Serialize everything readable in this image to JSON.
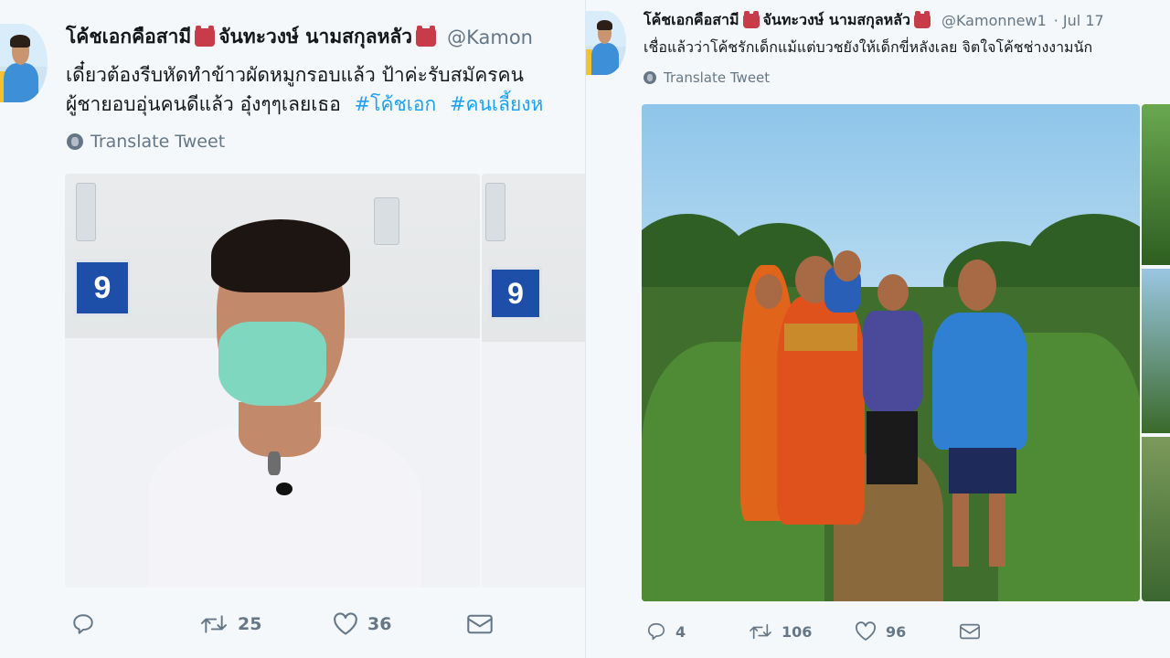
{
  "left_tweet": {
    "display_name": "โค้ชเอกคือสามี",
    "display_name_2": "จันทะวงษ์ นามสกุลหลัว",
    "handle": "@Kamon",
    "text_line_1": "เดี๋ยวต้องรีบหัดทำข้าวผัดหมูกรอบแล้ว ป้าค่ะรับสมัครคน",
    "text_line_2": "ผู้ชายอบอุ่นคนดีแล้ว อุ๋งๆๆเลยเธอ",
    "hashtag_1": "#โค้ชเอก",
    "hashtag_2": "#คนเลี้ยงห",
    "translate_label": "Translate Tweet",
    "bed_number": "9",
    "retweets": "25",
    "likes": "36"
  },
  "right_tweet": {
    "display_name": "โค้ชเอกคือสามี",
    "display_name_2": "จันทะวงษ์ นามสกุลหลัว",
    "handle": "@Kamonnew1",
    "timestamp": "· Jul 17",
    "text_line_1": "เชื่อแล้วว่าโค้ชรักเด็กแม้แต่บวชยังให้เด็กขี่หลังเลย จิตใจโค้ชช่างงามนัก",
    "translate_label": "Translate Tweet",
    "replies": "4",
    "retweets": "106",
    "likes": "96"
  },
  "colors": {
    "text": "#14171a",
    "muted": "#657786",
    "link": "#1da1f2",
    "background": "#f5f8fa",
    "emoji": "#c83c4a"
  },
  "icons": [
    "reply-icon",
    "retweet-icon",
    "like-icon",
    "dm-icon",
    "globe-icon",
    "pig-emoji-icon"
  ]
}
